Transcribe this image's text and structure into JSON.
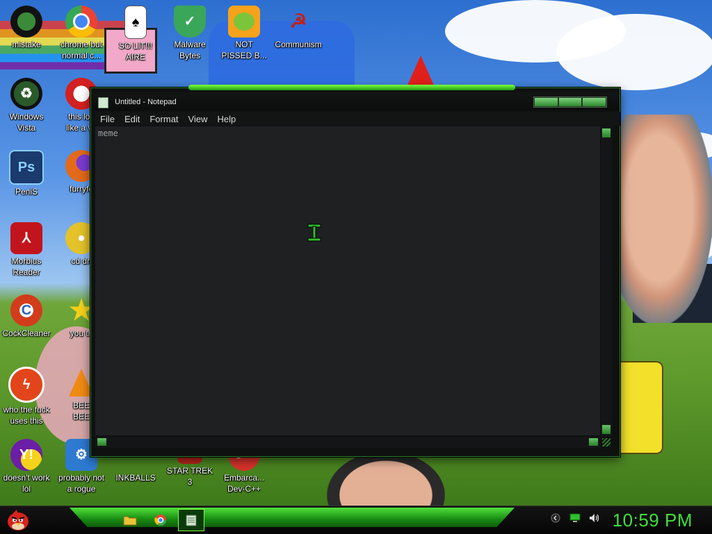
{
  "desktop": {
    "icons": [
      {
        "label": "mistake",
        "icon": "xbox-ball-icon",
        "color": "#2f7d2f"
      },
      {
        "label": "chrome but\nnormal c...",
        "icon": "chrome-icon",
        "color": "#e8e8e8"
      },
      {
        "label": "SO LIT!!!\nAIRE",
        "icon": "solitaire-card-icon",
        "color": "#f4f4f4"
      },
      {
        "label": "Malware\nBytes",
        "icon": "shield-check-icon",
        "color": "#3aa65a"
      },
      {
        "label": "NOT\nPISSED B...",
        "icon": "angry-pig-icon",
        "color": "#f6a21a"
      },
      {
        "label": "Communism",
        "icon": "communist-emblem-icon",
        "color": "#c0201a"
      },
      {
        "label": "Windows\nVista",
        "icon": "recycle-bin-icon",
        "color": "#2a5a2a"
      },
      {
        "label": "this loo\nlike a va",
        "icon": "opera-icon",
        "color": "#d32020"
      },
      {
        "label": "PeniS",
        "icon": "photoshop-icon",
        "color": "#1b3a6e"
      },
      {
        "label": "furryfo",
        "icon": "firefox-icon",
        "color": "#e26a1a"
      },
      {
        "label": "Morbius\nReader",
        "icon": "pdf-reader-icon",
        "color": "#c2141c"
      },
      {
        "label": "cd dri",
        "icon": "cd-drive-icon",
        "color": "#e3c22a"
      },
      {
        "label": "CockCleaner",
        "icon": "ccleaner-icon",
        "color": "#d23c1a"
      },
      {
        "label": "you tri",
        "icon": "star-icon",
        "color": "#f4d01a"
      },
      {
        "label": "who the fuck\nuses this",
        "icon": "flash-icon",
        "color": "#e2451a"
      },
      {
        "label": "BEE\nBEE",
        "icon": "vlc-cone-icon",
        "color": "#f08a12"
      },
      {
        "label": "doesn't work\nlol",
        "icon": "yahoo-messenger-icon",
        "color": "#6b1ea6"
      },
      {
        "label": "probably not\na rogue",
        "icon": "computer-gear-icon",
        "color": "#2e7ad0"
      },
      {
        "label": "INKBALLS",
        "icon": "inkball-icon",
        "color": "#1a1a1a"
      },
      {
        "label": "STAR TREK\n3",
        "icon": "star-wars-icon",
        "color": "#b8241c"
      },
      {
        "label": "Embarca...\nDev-C++",
        "icon": "cpp-icon",
        "color": "#d6322a"
      }
    ]
  },
  "notepad": {
    "title": "Untitled - Notepad",
    "menu": [
      "File",
      "Edit",
      "Format",
      "View",
      "Help"
    ],
    "content": "meme",
    "accent": "#2fbf2f"
  },
  "taskbar": {
    "start_icon": "angry-bird-icon",
    "pinned": [
      {
        "icon": "folder-icon",
        "color": "#e8c33a"
      },
      {
        "icon": "chrome-icon",
        "color": "#e8e8e8"
      }
    ],
    "active_app_icon": "notepad-icon",
    "tray": [
      "chevron-icon",
      "network-icon",
      "volume-icon"
    ],
    "clock": "10:59 PM",
    "clock_color": "#3fe03a"
  }
}
